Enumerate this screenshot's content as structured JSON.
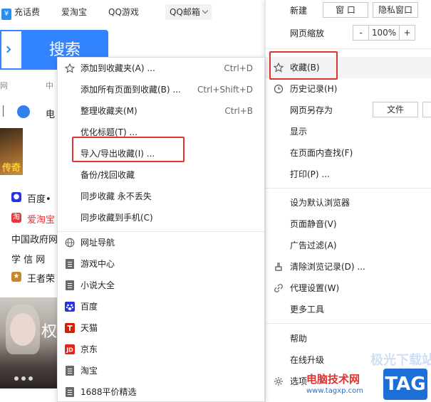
{
  "topnav": {
    "recharge": "充话费",
    "aitaobao": "爱淘宝",
    "qqgame": "QQ游戏",
    "qqmail": "QQ邮箱"
  },
  "search": {
    "button_label": "搜索"
  },
  "background_text": {
    "frag_jian": "网",
    "frag_zhong": "中",
    "frag_dian": "电",
    "chuanqi": "传奇",
    "baidu": "百度•",
    "aitaobao_link": "爱淘宝",
    "zhengfu": "中国政府网",
    "xuexin": "学 信 网",
    "wangzhe": "王者荣",
    "quan": "权"
  },
  "main_menu": {
    "new_label": "新建",
    "new_window": "窗 口",
    "private_window": "隐私窗口",
    "zoom_label": "网页缩放",
    "zoom_minus": "-",
    "zoom_value": "100%",
    "zoom_plus": "+",
    "items": [
      {
        "label": "收藏(B)",
        "icon": "star-icon"
      },
      {
        "label": "历史记录(H)",
        "icon": "clock-icon"
      },
      {
        "label": "网页另存为",
        "icon": ""
      },
      {
        "label": "显示",
        "icon": ""
      },
      {
        "label": "在页面内查找(F)",
        "icon": ""
      },
      {
        "label": "打印(P) ...",
        "icon": ""
      },
      {
        "label": "设为默认浏览器",
        "icon": ""
      },
      {
        "label": "页面静音(V)",
        "icon": ""
      },
      {
        "label": "广告过滤(A)",
        "icon": ""
      },
      {
        "label": "清除浏览记录(D) ...",
        "icon": "brush-icon"
      },
      {
        "label": "代理设置(W)",
        "icon": "link-icon"
      },
      {
        "label": "更多工具",
        "icon": ""
      },
      {
        "label": "帮助",
        "icon": ""
      },
      {
        "label": "在线升级",
        "icon": ""
      },
      {
        "label": "选项",
        "icon": "gear-icon"
      }
    ],
    "save_as_file": "文件"
  },
  "favorites_menu": {
    "items": [
      {
        "label": "添加到收藏夹(A) ...",
        "shortcut": "Ctrl+D",
        "icon": "star-icon"
      },
      {
        "label": "添加所有页面到收藏(B) ...",
        "shortcut": "Ctrl+Shift+D",
        "icon": ""
      },
      {
        "label": "整理收藏夹(M)",
        "shortcut": "Ctrl+B",
        "icon": ""
      },
      {
        "label": "优化标题(T) ...",
        "shortcut": "",
        "icon": ""
      },
      {
        "label": "导入/导出收藏(I) ...",
        "shortcut": "",
        "icon": ""
      },
      {
        "label": "备份/找回收藏",
        "shortcut": "",
        "icon": ""
      },
      {
        "label": "同步收藏 永不丢失",
        "shortcut": "",
        "icon": ""
      },
      {
        "label": "同步收藏到手机(C)",
        "shortcut": "",
        "icon": ""
      }
    ],
    "bookmarks": [
      {
        "label": "网址导航",
        "icon": "globe-icon"
      },
      {
        "label": "游戏中心",
        "icon": "doc-icon"
      },
      {
        "label": "小说大全",
        "icon": "doc-icon"
      },
      {
        "label": "百度",
        "icon": "baidu-paw-icon"
      },
      {
        "label": "天猫",
        "icon": "tmall-icon"
      },
      {
        "label": "京东",
        "icon": "jd-icon"
      },
      {
        "label": "淘宝",
        "icon": "doc-icon"
      },
      {
        "label": "1688平价精选",
        "icon": "doc-icon"
      }
    ]
  },
  "watermark": {
    "site_name": "电脑技术网",
    "site_url": "www.tagxp.com",
    "tag": "TAG",
    "faded": "极光下载站"
  },
  "colors": {
    "accent_blue": "#3385ff",
    "highlight_red": "#e0322f",
    "watermark_blue": "#1d6fd8"
  }
}
